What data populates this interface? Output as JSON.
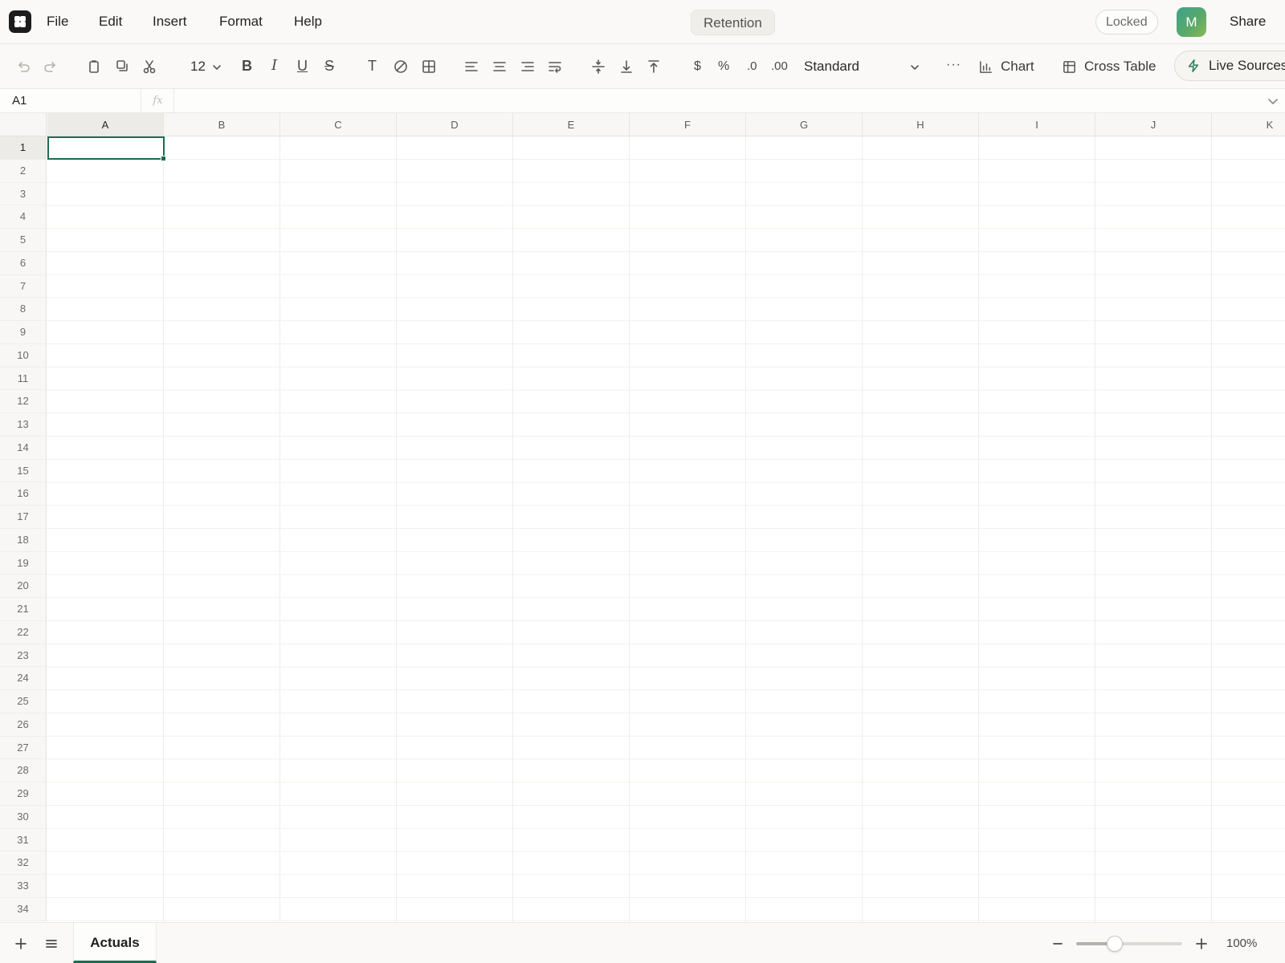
{
  "menubar": {
    "items": [
      "File",
      "Edit",
      "Insert",
      "Format",
      "Help"
    ],
    "doc_title": "Retention",
    "locked_label": "Locked",
    "avatar_initial": "M",
    "share_label": "Share"
  },
  "toolbar": {
    "font_size": "12",
    "bold": "B",
    "italic": "I",
    "underline": "U",
    "strike": "S",
    "clear_format": "T",
    "currency": "$",
    "percent": "%",
    "decrease_decimals": ".0",
    "increase_decimals": ".00",
    "number_format": "Standard",
    "more": "···",
    "chart_label": "Chart",
    "cross_table_label": "Cross Table",
    "live_sources_label": "Live Sources"
  },
  "formula_bar": {
    "cell_ref": "A1",
    "fx": "fx",
    "value": ""
  },
  "grid": {
    "columns": [
      "A",
      "B",
      "C",
      "D",
      "E",
      "F",
      "G",
      "H",
      "I",
      "J",
      "K"
    ],
    "rows": [
      "1",
      "2",
      "3",
      "4",
      "5",
      "6",
      "7",
      "8",
      "9",
      "10",
      "11",
      "12",
      "13",
      "14",
      "15",
      "16",
      "17",
      "18",
      "19",
      "20",
      "21",
      "22",
      "23",
      "24",
      "25",
      "26",
      "27",
      "28",
      "29",
      "30",
      "31",
      "32",
      "33",
      "34"
    ],
    "active_cell": "A1"
  },
  "bottom": {
    "active_sheet": "Actuals",
    "zoom": "100%"
  },
  "colors": {
    "accent": "#1e6b52",
    "live_icon": "#2e7d5b"
  },
  "icons": [
    "app-logo-icon",
    "undo-icon",
    "redo-icon",
    "paste-icon",
    "copy-icon",
    "cut-icon",
    "chevron-down-icon",
    "clear-icon",
    "borders-icon",
    "align-left-icon",
    "align-center-icon",
    "align-right-icon",
    "wrap-icon",
    "valign-middle-icon",
    "valign-bottom-icon",
    "valign-top-icon",
    "chart-icon",
    "cross-table-icon",
    "bolt-icon",
    "plus-icon",
    "menu-icon",
    "minus-icon"
  ]
}
